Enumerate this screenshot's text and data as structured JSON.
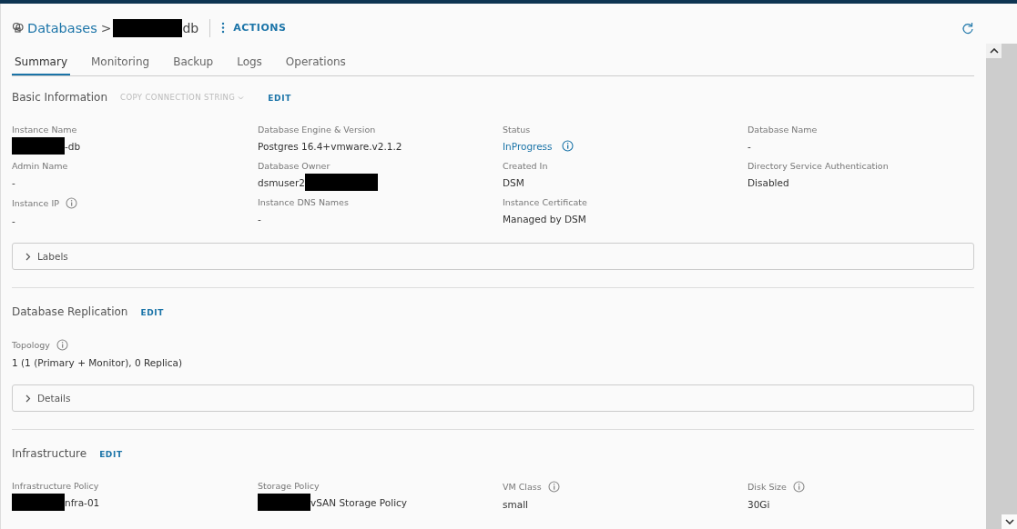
{
  "header": {
    "breadcrumb": "Databases",
    "separator": ">",
    "title_suffix": "db",
    "actions": "ACTIONS"
  },
  "tabs": [
    {
      "label": "Summary",
      "selected": true
    },
    {
      "label": "Monitoring",
      "selected": false
    },
    {
      "label": "Backup",
      "selected": false
    },
    {
      "label": "Logs",
      "selected": false
    },
    {
      "label": "Operations",
      "selected": false
    }
  ],
  "sections": [
    {
      "title": "Basic Information",
      "extra_action": {
        "label": "COPY CONNECTION STRING",
        "disabled": true
      },
      "edit": "EDIT",
      "fields": [
        {
          "label": "Instance Name",
          "value": "-db",
          "redacted_before": true
        },
        {
          "label": "Database Engine & Version",
          "value": "Postgres 16.4+vmware.v2.1.2"
        },
        {
          "label": "Status",
          "value": "InProgress",
          "kind": "link",
          "info": true
        },
        {
          "label": "Database Name",
          "value": "-"
        },
        {
          "label": "Admin Name",
          "value": "-"
        },
        {
          "label": "Database Owner",
          "value": "dsmuser2",
          "redacted_after": true
        },
        {
          "label": "Created In",
          "value": "DSM"
        },
        {
          "label": "Directory Service Authentication",
          "value": "Disabled"
        },
        {
          "label": "Instance IP",
          "value": "-",
          "label_info": true
        },
        {
          "label": "Instance DNS Names",
          "value": "-"
        },
        {
          "label": "Instance Certificate",
          "value": "Managed by DSM"
        }
      ],
      "collapsible": {
        "label": "Labels",
        "expanded": false
      }
    },
    {
      "title": "Database Replication",
      "edit": "EDIT",
      "fields": [
        {
          "label": "Topology",
          "value": "1 (1 (Primary + Monitor), 0 Replica)",
          "label_info": true
        }
      ],
      "collapsible": {
        "label": "Details",
        "expanded": false
      }
    },
    {
      "title": "Infrastructure",
      "edit": "EDIT",
      "fields": [
        {
          "label": "Infrastructure Policy",
          "value": "nfra-01",
          "redacted_before": true
        },
        {
          "label": "Storage Policy",
          "value": "vSAN Storage Policy",
          "redacted_before": true
        },
        {
          "label": "VM Class",
          "value": "small",
          "label_info": true
        },
        {
          "label": "Disk Size",
          "value": "30Gi",
          "label_info": true
        }
      ]
    }
  ]
}
